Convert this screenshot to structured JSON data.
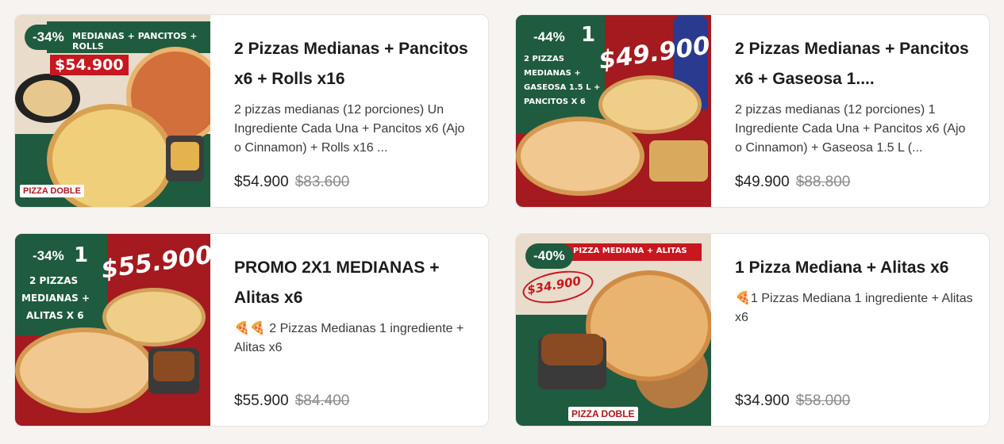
{
  "cards": [
    {
      "badge": "-34%",
      "banner": "MEDIANAS + PANCITOS + ROLLS",
      "price_tag": "$54.900",
      "brand": "PIZZA DOBLE",
      "title": "2 Pizzas Medianas + Pancitos x6 + Rolls x16",
      "description": "2 pizzas medianas (12 porciones) Un Ingrediente Cada Una + Pancitos x6 (Ajo o Cinnamon) + Rolls x16 ...",
      "price": "$54.900",
      "old_price": "$83.600"
    },
    {
      "badge": "-44%",
      "promo_number": "1",
      "promo_lines": [
        "2 PIZZAS",
        "MEDIANAS +",
        "GASEOSA 1.5 L +",
        "PANCITOS X 6"
      ],
      "price_tag": "$49.900",
      "title": "2 Pizzas Medianas + Pancitos x6 + Gaseosa 1....",
      "description": "2 pizzas medianas (12 porciones)  1 Ingrediente Cada Una + Pancitos x6 (Ajo o Cinnamon) + Gaseosa 1.5 L (...",
      "price": "$49.900",
      "old_price": "$88.800"
    },
    {
      "badge": "-34%",
      "promo_number": "1",
      "promo_lines": [
        "2 PIZZAS",
        "MEDIANAS +",
        "ALITAS X 6"
      ],
      "price_tag": "$55.900",
      "title": "PROMO 2X1 MEDIANAS + Alitas x6",
      "description": "🍕🍕 2 Pizzas Medianas 1 ingrediente + Alitas x6",
      "price": "$55.900",
      "old_price": "$84.400"
    },
    {
      "badge": "-40%",
      "banner": "PIZZA MEDIANA + ALITAS",
      "price_tag": "$34.900",
      "brand": "PIZZA DOBLE",
      "title": "1 Pizza Mediana + Alitas x6",
      "description": "🍕1 Pizzas Mediana 1 ingrediente + Alitas x6",
      "price": "$34.900",
      "old_price": "$58.000"
    }
  ],
  "colors": {
    "badge_green": "#1f5b3f",
    "promo_red": "#b0151d",
    "page_bg": "#f6f3f1"
  }
}
